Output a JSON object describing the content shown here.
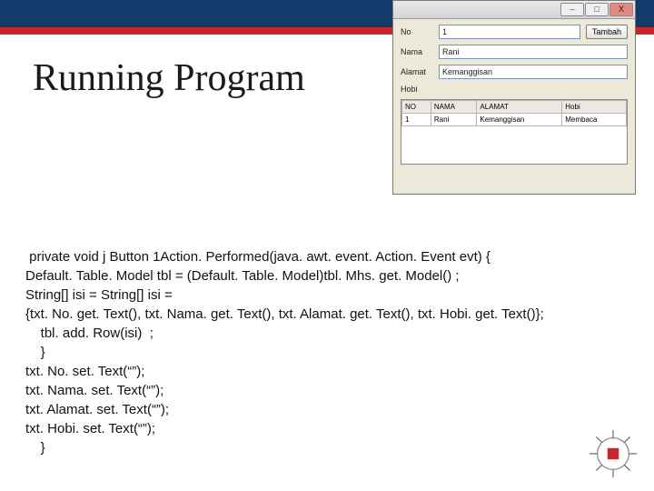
{
  "slide": {
    "title": "Running Program"
  },
  "code": {
    "line1": " private void j Button 1Action. Performed(java. awt. event. Action. Event evt) {",
    "line2": "Default. Table. Model tbl = (Default. Table. Model)tbl. Mhs. get. Model() ;",
    "line3": "String[] isi = String[] isi =",
    "line4": "{txt. No. get. Text(), txt. Nama. get. Text(), txt. Alamat. get. Text(), txt. Hobi. get. Text()};",
    "line5": "    tbl. add. Row(isi)  ;",
    "line6": "    }",
    "line7": "txt. No. set. Text(“”);",
    "line8": "txt. Nama. set. Text(“”);",
    "line9": "txt. Alamat. set. Text(“”);",
    "line10": "txt. Hobi. set. Text(“”);",
    "line11": "    }"
  },
  "app": {
    "titlebar": {
      "min": "–",
      "max": "□",
      "close": "X"
    },
    "labels": {
      "no": "No",
      "nama": "Nama",
      "alamat": "Alamat",
      "hobi": "Hobi"
    },
    "values": {
      "no": "1",
      "nama": "Rani",
      "alamat": "Kemanggisan",
      "hobi": ""
    },
    "button": "Tambah",
    "table": {
      "headers": [
        "NO",
        "NAMA",
        "ALAMAT",
        "Hobi"
      ],
      "rows": [
        [
          "1",
          "Rani",
          "Kemanggisan",
          "Membaca"
        ]
      ]
    }
  }
}
